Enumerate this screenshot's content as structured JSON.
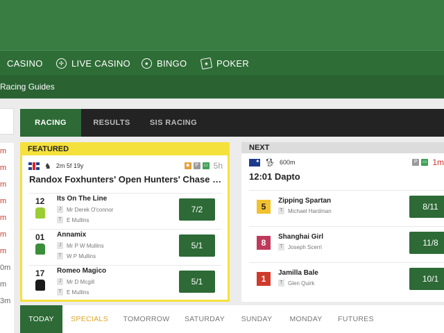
{
  "nav": {
    "items": [
      {
        "label": "CASINO",
        "icon": "none"
      },
      {
        "label": "LIVE CASINO",
        "icon": "roulette-icon"
      },
      {
        "label": "BINGO",
        "icon": "bingo-ball-icon"
      },
      {
        "label": "POKER",
        "icon": "poker-cards-icon"
      }
    ]
  },
  "subnav": {
    "label": "Racing Guides"
  },
  "sidebar": {
    "items": [
      "m",
      "m",
      "m",
      "m",
      "m",
      "m",
      "m",
      "0m",
      "m",
      "3m"
    ]
  },
  "racing_tabs": [
    "RACING",
    "RESULTS",
    "SIS RACING"
  ],
  "featured": {
    "header": "FEATURED",
    "distance": "2m 5f 19y",
    "countdown": "5h",
    "title": "Randox Foxhunters' Open Hunters' Chase (Nat...",
    "runners": [
      {
        "number": "12",
        "name": "Its On The Line",
        "jockey": "Mr Derek O'connor",
        "trainer": "E Mullins",
        "odds": "7/2",
        "silks_color": "#9acd32"
      },
      {
        "number": "01",
        "name": "Annamix",
        "jockey": "Mr P W Mullins",
        "trainer": "W P Mullins",
        "odds": "5/1",
        "silks_color": "#3a8f3a"
      },
      {
        "number": "17",
        "name": "Romeo Magico",
        "jockey": "Mr D Mcgill",
        "trainer": "E Mullins",
        "odds": "5/1",
        "silks_color": "#1a1a1a"
      }
    ],
    "jockey_tag": "J",
    "trainer_tag": "T"
  },
  "next": {
    "header": "NEXT",
    "distance": "600m",
    "countdown": "1m",
    "title": "12:01 Dapto",
    "runners": [
      {
        "number": "5",
        "name": "Zipping Spartan",
        "trainer": "Michael Hardman",
        "odds": "8/11",
        "badge_color": "#f2c12e",
        "badge_text_color": "#222"
      },
      {
        "number": "8",
        "name": "Shanghai Girl",
        "trainer": "Joseph Scerri",
        "odds": "11/8",
        "badge_color": "#c0395a",
        "badge_text_color": "#fff"
      },
      {
        "number": "1",
        "name": "Jamilla Bale",
        "trainer": "Glen Quirk",
        "odds": "10/1",
        "badge_color": "#d03a2b",
        "badge_text_color": "#fff"
      }
    ],
    "trainer_tag": "T"
  },
  "day_tabs": [
    "TODAY",
    "SPECIALS",
    "TOMORROW",
    "SATURDAY",
    "SUNDAY",
    "MONDAY",
    "FUTURES"
  ],
  "colors": {
    "brand_green": "#3a7d43",
    "accent_yellow": "#f5e13c",
    "odds_button": "#2d6a36"
  }
}
